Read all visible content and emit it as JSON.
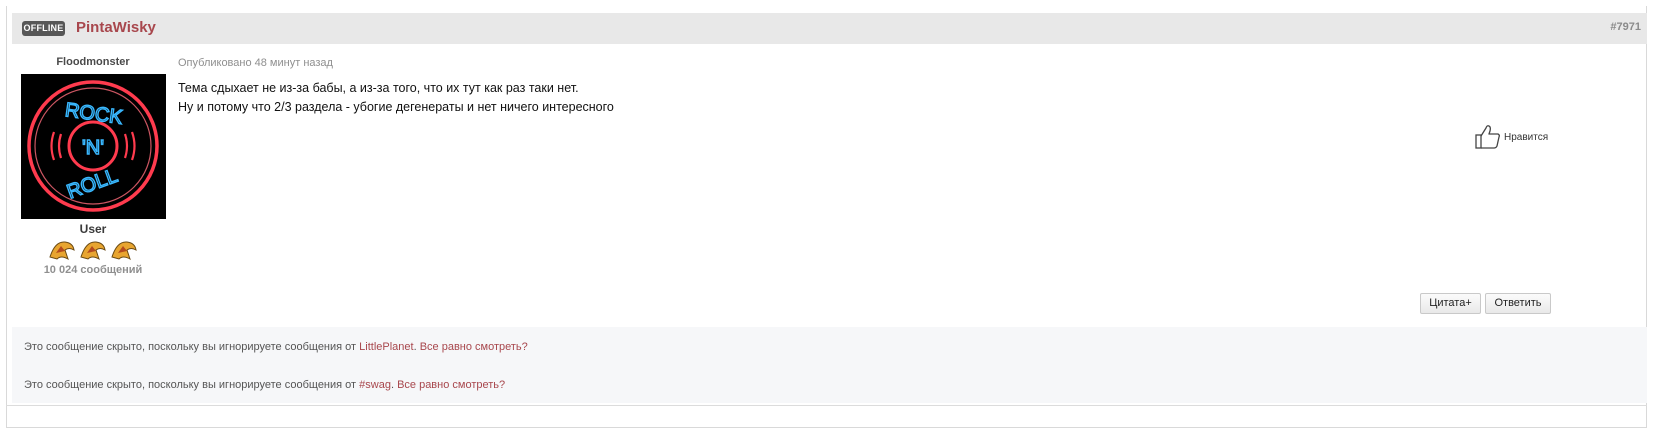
{
  "post": {
    "status_badge": "OFFLINE",
    "author": "PintaWisky",
    "number": "#7971",
    "author_title": "Floodmonster",
    "group": "User",
    "post_count": "10 024 сообщений",
    "published": "Опубликовано 48 минут назад",
    "body": [
      "Тема сдыхает не из-за бабы, а из-за того, что их тут как раз таки нет.",
      "Ну и потому что 2/3 раздела - убогие дегенераты и нет ничего интересного"
    ],
    "like_label": "Нравится",
    "quote_label": "Цитата+",
    "reply_label": "Ответить",
    "avatar_text": {
      "top": "ROCK",
      "middle": "'N'",
      "bottom": "ROLL"
    },
    "colors": {
      "accent": "#a8474d",
      "header_bg": "#e8e8e8",
      "badge_bg": "#575757",
      "neon_red": "#ff3b4e",
      "neon_blue": "#39b8ff"
    }
  },
  "hidden_messages": [
    {
      "text": "Это сообщение скрыто, поскольку вы игнорируете сообщения от ",
      "user": "LittlePlanet",
      "sep": ".",
      "link": "Все равно смотреть?"
    },
    {
      "text": "Это сообщение скрыто, поскольку вы игнорируете сообщения от ",
      "user": "#swag",
      "sep": ".",
      "link": "Все равно смотреть?"
    }
  ]
}
